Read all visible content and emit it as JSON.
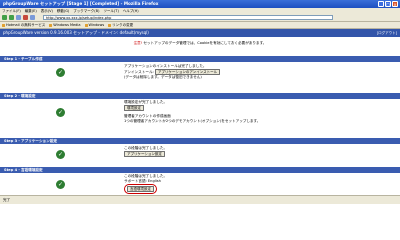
{
  "window": {
    "title": "phpGroupWare セットアップ [Stage 1] [Completed] - Mozilla Firefox"
  },
  "menubar": {
    "items": [
      "ファイル(F)",
      "編集(E)",
      "表示(V)",
      "移動(G)",
      "ブックマーク(B)",
      "ツール(T)",
      "ヘルプ(H)"
    ]
  },
  "toolbar": {
    "address": "http://www.xx.xxx.jp/setup/index.php"
  },
  "bookmarks": {
    "items": [
      "Hotmail の無料サービス",
      "Windows Media",
      "Windows",
      "リンクの変更"
    ]
  },
  "app": {
    "header_title": "phpGroupWare version 0.9.16.003 セットアップ - ドメイン: default(mysql)",
    "header_right": "[ログアウト]",
    "notice_warn": "注意!",
    "notice_text": "セットアップのデータ管理では、Cookieを有効にしておく必要があります。",
    "steps": [
      {
        "head": "Step 1 - テーブル作成",
        "line1": "アプリケーションのインストールは完了しました。",
        "line2_label": "アンインストール:",
        "line2_button": "アプリケーションのアンインストール",
        "line3": "(データは削除します。データは復旧できません)"
      },
      {
        "head": "Step 2 - 環境設定",
        "line1": "環境設定が完了しました。",
        "line1_button": "環境設定",
        "line2": "管理者アカウントの作成画面",
        "line3": "1つの管理者アカウントか2つのデモアカウント(オプション)をセットアップします。"
      },
      {
        "head": "Step 3 - アプリケーション設定",
        "line1": "この段階は完了しました。",
        "line1_button": "アプリケーション設定"
      },
      {
        "head": "Step 4 - 言語環境設定",
        "line1": "この段階は完了しました。",
        "line2": "サポート言語: English",
        "line3_button": "言語環境設定"
      }
    ]
  },
  "statusbar": {
    "text": "完了"
  }
}
